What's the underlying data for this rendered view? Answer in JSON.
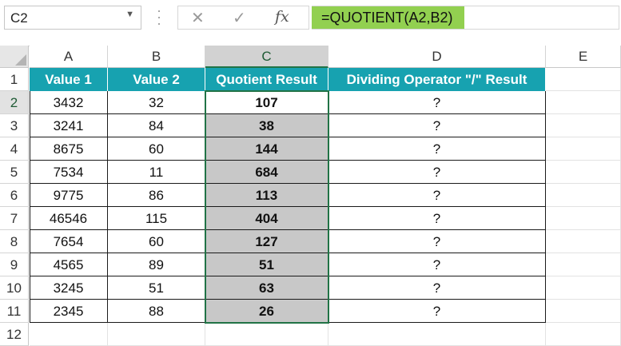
{
  "name_box": "C2",
  "formula": "=QUOTIENT(A2,B2)",
  "toolbar_icons": [
    "cancel-icon",
    "enter-icon",
    "function-icon"
  ],
  "columns": [
    "A",
    "B",
    "C",
    "D",
    "E"
  ],
  "row_numbers": [
    "1",
    "2",
    "3",
    "4",
    "5",
    "6",
    "7",
    "8",
    "9",
    "10",
    "11",
    "12"
  ],
  "header_row": [
    "Value 1",
    "Value 2",
    "Quotient Result",
    "Dividing Operator \"/\" Result"
  ],
  "rows": [
    [
      "3432",
      "32",
      "107",
      "?"
    ],
    [
      "3241",
      "84",
      "38",
      "?"
    ],
    [
      "8675",
      "60",
      "144",
      "?"
    ],
    [
      "7534",
      "11",
      "684",
      "?"
    ],
    [
      "9775",
      "86",
      "113",
      "?"
    ],
    [
      "46546",
      "115",
      "404",
      "?"
    ],
    [
      "7654",
      "60",
      "127",
      "?"
    ],
    [
      "4565",
      "89",
      "51",
      "?"
    ],
    [
      "3245",
      "51",
      "63",
      "?"
    ],
    [
      "2345",
      "88",
      "26",
      "?"
    ]
  ],
  "colors": {
    "header_fill": "#17a2b0",
    "formula_highlight": "#92d050",
    "selection": "#217346",
    "selected_fill": "#c8c8c8"
  }
}
